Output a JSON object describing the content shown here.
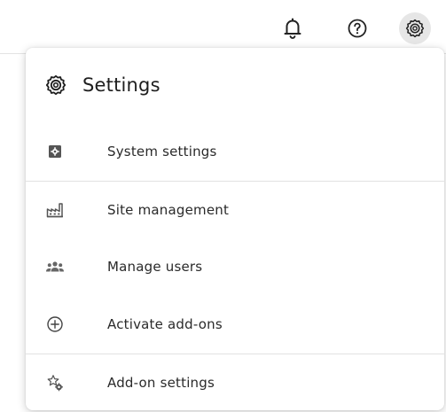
{
  "topbar": {
    "icons": [
      {
        "name": "notifications",
        "icon": "bell-icon"
      },
      {
        "name": "help",
        "icon": "question-circle-icon"
      },
      {
        "name": "settings",
        "icon": "gear-icon",
        "active": true
      }
    ]
  },
  "menu": {
    "title": "Settings",
    "title_icon": "gear-icon",
    "items": [
      {
        "label": "System settings",
        "icon": "system-settings-icon"
      },
      {
        "label": "Site management",
        "icon": "factory-icon"
      },
      {
        "label": "Manage users",
        "icon": "users-group-icon"
      },
      {
        "label": "Activate add-ons",
        "icon": "plus-circle-icon"
      },
      {
        "label": "Add-on settings",
        "icon": "star-gear-icon"
      }
    ]
  },
  "colors": {
    "icon": "#2b2b2b",
    "muted_icon": "#6b6b6b",
    "active_bg": "#e6e6e6",
    "divider": "#e2e2e2"
  }
}
